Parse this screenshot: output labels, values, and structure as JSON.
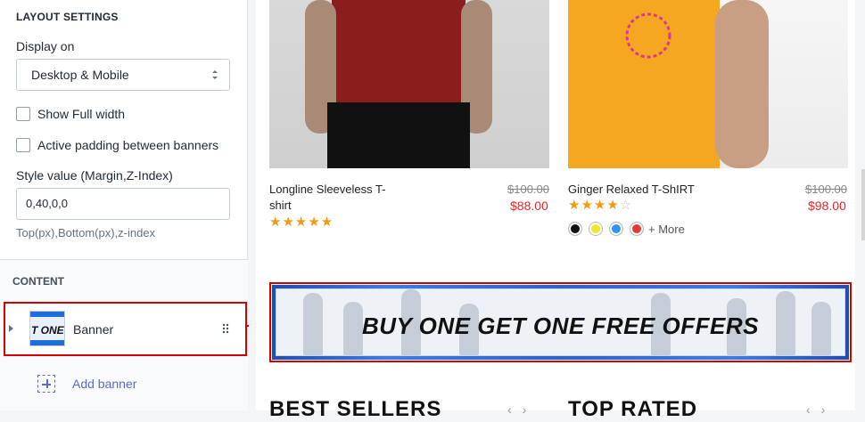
{
  "sidebar": {
    "layout_heading": "LAYOUT SETTINGS",
    "display_on_label": "Display on",
    "display_on_value": "Desktop & Mobile",
    "show_full_width": "Show Full width",
    "active_padding": "Active padding between banners",
    "style_value_label": "Style value (Margin,Z-Index)",
    "style_value": "0,40,0,0",
    "style_hint": "Top(px),Bottom(px),z-index",
    "content_heading": "CONTENT",
    "banner_item_label": "Banner",
    "banner_thumb_text": "T ONE I",
    "add_banner_label": "Add banner"
  },
  "preview": {
    "products": [
      {
        "name_line1": "Longline Sleeveless T-",
        "name_line2": "shirt",
        "old_price": "$100.00",
        "new_price": "$88.00",
        "rating": 5
      },
      {
        "name_line1": "Ginger Relaxed T-ShIRT",
        "name_line2": "",
        "old_price": "$100.00",
        "new_price": "$98.00",
        "rating": 4
      }
    ],
    "swatch_colors": [
      "#111111",
      "#f5e62b",
      "#2f96f0",
      "#e53935"
    ],
    "more_label": "+ More",
    "promo_text": "BUY ONE GET ONE FREE OFFERS",
    "section_left": "BEST SELLERS",
    "section_right": "TOP RATED",
    "accent_color": "#d50000"
  }
}
